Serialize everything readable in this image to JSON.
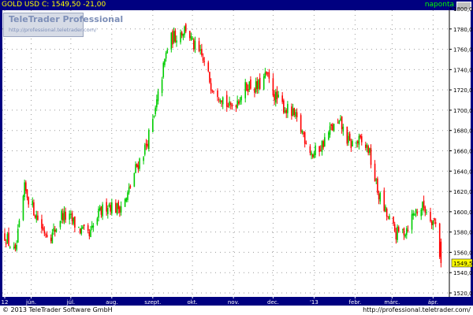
{
  "header": {
    "symbol_line": "GOLD USD C: 1549,50 -21,00",
    "interval": "naponta"
  },
  "logo": {
    "title": "TeleTrader Professional",
    "url": "http://professional.teletrader.com/"
  },
  "footer": {
    "copyright": "© 2013 TeleTrader Software GmbH",
    "url": "http://professional.teletrader.com/"
  },
  "colors": {
    "up": "#00cc00",
    "down": "#ff0000",
    "frame": "#000080",
    "last_price_bg": "#ffff00"
  },
  "chart_data": {
    "type": "candlestick",
    "ylim": [
      1520,
      1800
    ],
    "y_ticks": [
      "1520,00",
      "1540,00",
      "1560,00",
      "1580,00",
      "1600,00",
      "1620,00",
      "1640,00",
      "1660,00",
      "1680,00",
      "1700,00",
      "1720,00",
      "1740,00",
      "1760,00",
      "1780,00",
      "1800,00"
    ],
    "y_tick_values": [
      1520,
      1540,
      1560,
      1580,
      1600,
      1620,
      1640,
      1660,
      1680,
      1700,
      1720,
      1740,
      1760,
      1780,
      1800
    ],
    "x_ticks": [
      "12",
      "jún.",
      "júl.",
      "aug.",
      "szept.",
      "okt.",
      "nov.",
      "dec.",
      "'13",
      "febr.",
      "márc.",
      "ápr."
    ],
    "x_tick_days": [
      0,
      20,
      50,
      81,
      112,
      142,
      173,
      203,
      234,
      265,
      293,
      324
    ],
    "last_price": {
      "label": "1549,50",
      "value": 1549.5
    },
    "grid": true,
    "series_close": [
      [
        0,
        1577
      ],
      [
        8,
        1558
      ],
      [
        15,
        1622
      ],
      [
        22,
        1602
      ],
      [
        29,
        1582
      ],
      [
        36,
        1577
      ],
      [
        43,
        1597
      ],
      [
        50,
        1592
      ],
      [
        57,
        1582
      ],
      [
        64,
        1575
      ],
      [
        71,
        1597
      ],
      [
        78,
        1608
      ],
      [
        85,
        1603
      ],
      [
        92,
        1612
      ],
      [
        99,
        1642
      ],
      [
        106,
        1662
      ],
      [
        113,
        1692
      ],
      [
        118,
        1728
      ],
      [
        124,
        1768
      ],
      [
        131,
        1775
      ],
      [
        138,
        1782
      ],
      [
        142,
        1765
      ],
      [
        149,
        1752
      ],
      [
        156,
        1726
      ],
      [
        163,
        1716
      ],
      [
        170,
        1702
      ],
      [
        177,
        1712
      ],
      [
        184,
        1725
      ],
      [
        191,
        1722
      ],
      [
        198,
        1734
      ],
      [
        205,
        1712
      ],
      [
        212,
        1702
      ],
      [
        219,
        1694
      ],
      [
        226,
        1676
      ],
      [
        233,
        1656
      ],
      [
        240,
        1666
      ],
      [
        247,
        1682
      ],
      [
        254,
        1686
      ],
      [
        261,
        1666
      ],
      [
        268,
        1669
      ],
      [
        275,
        1662
      ],
      [
        282,
        1620
      ],
      [
        289,
        1596
      ],
      [
        296,
        1578
      ],
      [
        303,
        1582
      ],
      [
        310,
        1600
      ],
      [
        317,
        1605
      ],
      [
        321,
        1597
      ],
      [
        326,
        1588
      ],
      [
        330,
        1549.5
      ]
    ]
  }
}
